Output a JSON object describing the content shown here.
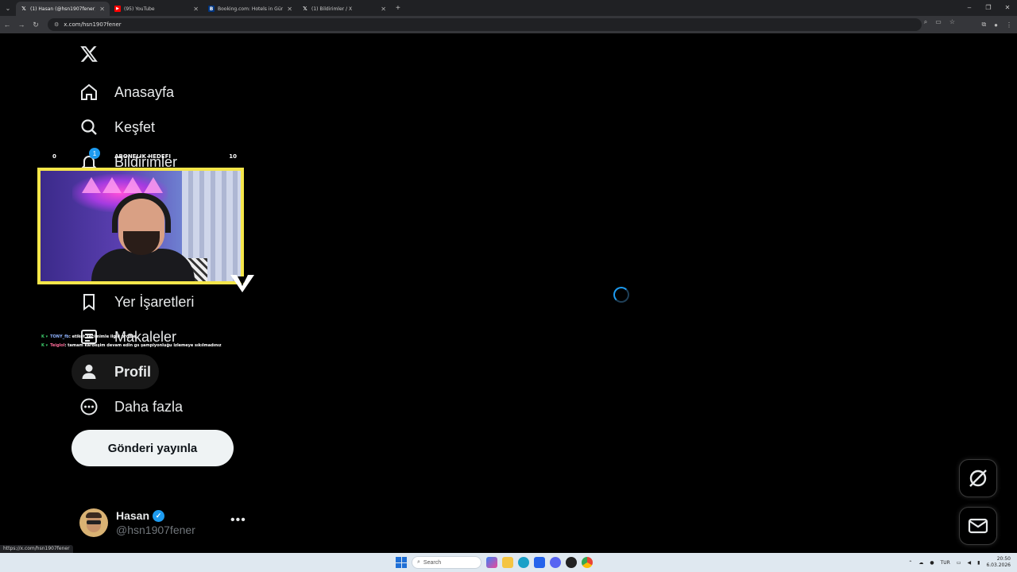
{
  "browser": {
    "tabs": [
      {
        "title": "(1) Hasan (@hsn1907fener) / X",
        "icon": "x-favicon",
        "active": true
      },
      {
        "title": "(95) YouTube",
        "icon": "youtube-favicon",
        "active": false
      },
      {
        "title": "Booking.com: Hotels in Güney",
        "icon": "booking-favicon",
        "active": false
      },
      {
        "title": "(1) Bildirimler / X",
        "icon": "x-favicon",
        "active": false
      }
    ],
    "url": "x.com/hsn1907fener",
    "status_url": "https://x.com/hsn1907fener"
  },
  "sidebar": {
    "items": [
      {
        "label": "Anasayfa",
        "icon": "home-icon"
      },
      {
        "label": "Keşfet",
        "icon": "search-icon"
      },
      {
        "label": "Bildirimler",
        "icon": "bell-icon",
        "badge": "1"
      },
      {
        "label": "Yer İşaretleri",
        "icon": "bookmark-icon"
      },
      {
        "label": "Makaleler",
        "icon": "article-icon"
      },
      {
        "label": "Profil",
        "icon": "person-icon"
      },
      {
        "label": "Daha fazla",
        "icon": "more-circle-icon"
      }
    ],
    "post_button": "Gönderi yayınla"
  },
  "profile": {
    "name": "Hasan",
    "handle": "@hsn1907fener",
    "more": "•••"
  },
  "overlay": {
    "goal_start": "0",
    "goal_title": "ABONELIK HEDEFI",
    "goal_end": "10",
    "chat": [
      {
        "user": "TONY_fb",
        "text": ": etiket seçimimle ilgili profile"
      },
      {
        "user": "Teiglol",
        "text": ": tamam kardeşim devam edin gs şampiyonluğu izlemeye sıkılmadınız"
      }
    ]
  },
  "taskbar": {
    "search_placeholder": "Search",
    "lang": "TUR",
    "time": "20:50",
    "date": "6.03.2026"
  },
  "colors": {
    "accent": "#1d9bf0",
    "background": "#000000",
    "overlay_border": "#f5e64a"
  }
}
